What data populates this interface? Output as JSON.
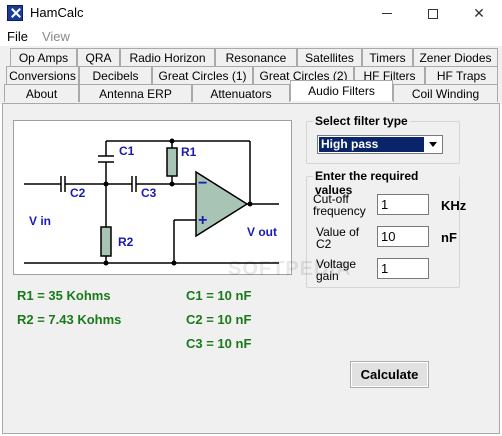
{
  "window": {
    "title": "HamCalc",
    "minimize": "—",
    "maximize": "☐",
    "close": "✕"
  },
  "menu": [
    {
      "label": "File",
      "disabled": false
    },
    {
      "label": "View",
      "disabled": true
    }
  ],
  "tabs": {
    "row1": [
      "Op Amps",
      "QRA",
      "Radio Horizon",
      "Resonance",
      "Satellites",
      "Timers",
      "Zener Diodes"
    ],
    "row2": [
      "Conversions",
      "Decibels",
      "Great Circles (1)",
      "Great Circles (2)",
      "HF Filters",
      "HF Traps"
    ],
    "row3": [
      "About",
      "Antenna ERP",
      "Attenuators",
      "Audio Filters",
      "Coil Winding"
    ],
    "active": "Audio Filters"
  },
  "circuit": {
    "labels": {
      "c1": "C1",
      "c2": "C2",
      "c3": "C3",
      "r1": "R1",
      "r2": "R2",
      "vin": "V in",
      "vout": "V out",
      "minus": "−",
      "plus": "+"
    },
    "colors": {
      "label": "#1a1ab0",
      "opamp": "#a8c4b4",
      "wire": "#000000",
      "resistor": "#a8c4b4"
    }
  },
  "results": {
    "r1": "R1 = 35 Kohms",
    "r2": "R2 = 7.43 Kohms",
    "c1": "C1 = 10 nF",
    "c2": "C2 = 10 nF",
    "c3": "C3 = 10 nF",
    "color": "#1a7a1a"
  },
  "filter_type": {
    "title": "Select filter type",
    "selected": "High pass"
  },
  "required_values": {
    "title": "Enter the required values",
    "cutoff_label_1": "Cut-off",
    "cutoff_label_2": "frequency",
    "cutoff_value": "1",
    "cutoff_unit": "KHz",
    "c2_label_1": "Value of",
    "c2_label_2": "C2",
    "c2_value": "10",
    "c2_unit": "nF",
    "gain_label_1": "Voltage",
    "gain_label_2": "gain",
    "gain_value": "1"
  },
  "calculate_label": "Calculate",
  "watermark": "SOFTPEDIA"
}
